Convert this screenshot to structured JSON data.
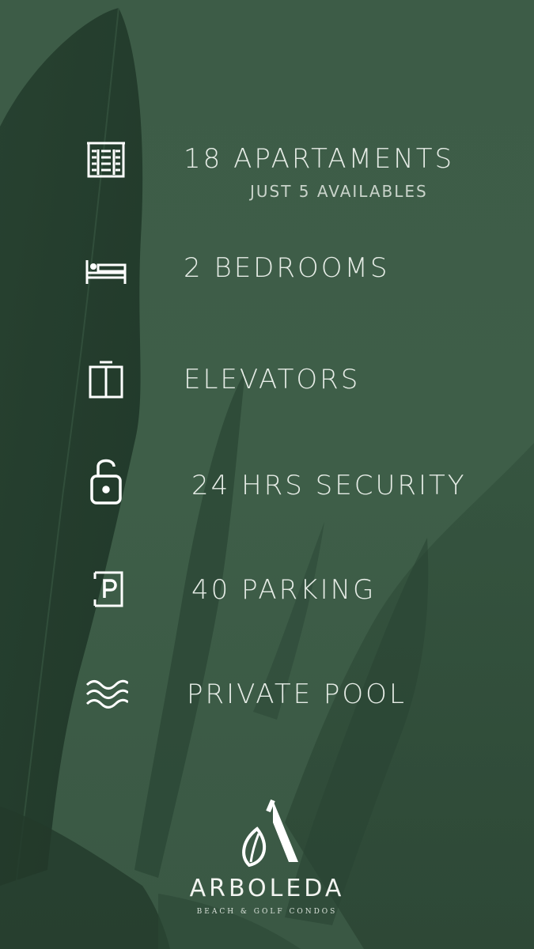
{
  "features": [
    {
      "label": "18 APARTAMENTS",
      "sub": "JUST 5 AVAILABLES",
      "icon": "building-icon"
    },
    {
      "label": "2 BEDROOMS",
      "icon": "bed-icon"
    },
    {
      "label": "ELEVATORS",
      "icon": "elevator-icon"
    },
    {
      "label": "24 HRS SECURITY",
      "icon": "padlock-icon"
    },
    {
      "label": "40 PARKING",
      "icon": "parking-icon"
    },
    {
      "label": "PRIVATE POOL",
      "icon": "waves-icon"
    }
  ],
  "brand": {
    "name": "ARBOLEDA",
    "tagline": "BEACH & GOLF CONDOS",
    "logo_icon": "leaf-a-logo-icon"
  },
  "colors": {
    "background": "#3f5e48",
    "text": "#e6ece6",
    "icon": "#ffffff"
  }
}
